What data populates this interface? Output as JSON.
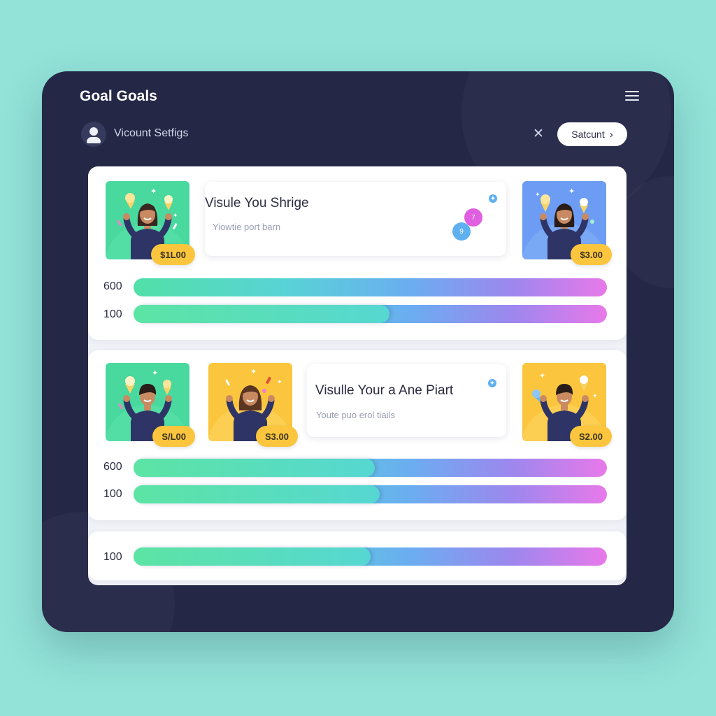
{
  "app": {
    "title": "Goal Goals"
  },
  "header": {
    "account_label": "Vicount Setfigs",
    "close_glyph": "✕",
    "button_label": "Satcunt",
    "button_chevron": "›"
  },
  "icons": [
    "menu-icon",
    "user-icon",
    "close-icon",
    "chevron-right-icon",
    "sparkle-icon",
    "ice-cream-icon",
    "confetti-icon"
  ],
  "colors": {
    "background": "#93e3d9",
    "window": "#242746",
    "price_badge": "#fbc63d",
    "tile_green": "#49d89e",
    "tile_blue": "#6c9cf3",
    "tile_yellow": "#fbc63d",
    "dot_pink": "#e05ee0",
    "dot_blue": "#5fb0f0"
  },
  "goals": [
    {
      "info": {
        "title": "Visule You Shrige",
        "subtitle": "Yiowtie port barn",
        "dot_pink": "7",
        "dot_blue": "9"
      },
      "tiles": [
        {
          "price": "$1L00",
          "color": "green"
        },
        {
          "price": "$3.00",
          "color": "blue"
        }
      ],
      "bars": [
        {
          "label": "600",
          "progress": 1.0
        },
        {
          "label": "100",
          "progress": 0.54
        }
      ]
    },
    {
      "info": {
        "title": "Visulle Your a Ane Piart",
        "subtitle": "Youte puo erol tiails"
      },
      "tiles": [
        {
          "price": "S/L00",
          "color": "green"
        },
        {
          "price": "S3.00",
          "color": "yellow"
        },
        {
          "price": "S2.00",
          "color": "yellow"
        }
      ],
      "bars": [
        {
          "label": "600",
          "progress": 0.51
        },
        {
          "label": "100",
          "progress": 0.52
        }
      ]
    },
    {
      "bars": [
        {
          "label": "100",
          "progress": 0.5
        }
      ]
    }
  ]
}
